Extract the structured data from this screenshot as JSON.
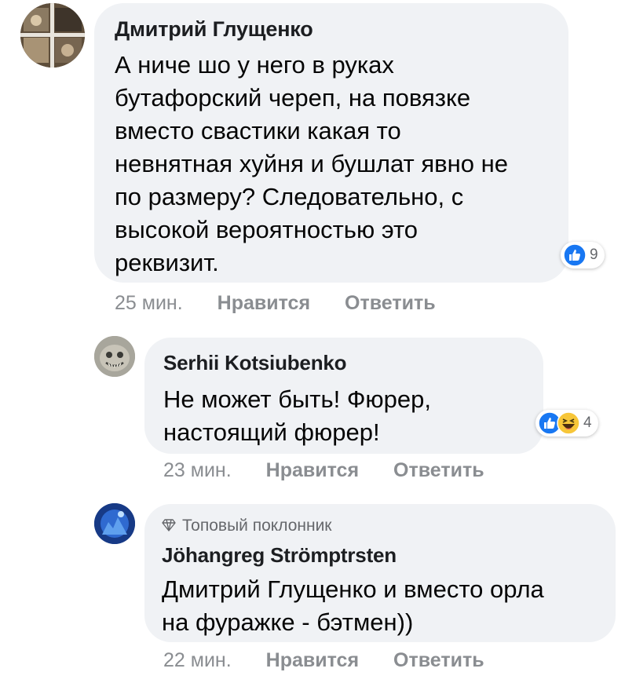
{
  "comments": [
    {
      "author": "Дмитрий Глущенко",
      "text": "А ниче шо у него в руках\nбутафорский череп, на повязке\nвместо свастики какая то\nневнятная хуйня и бушлат явно не\nпо размеру? Следовательно, с\nвысокой вероятностью это\nреквизит.",
      "reactions": {
        "icons": [
          "like-icon"
        ],
        "count": "9"
      },
      "time": "25 мин.",
      "like_label": "Нравится",
      "reply_label": "Ответить"
    },
    {
      "author": "Serhii Kotsiubenko",
      "text": "Не может быть! Фюрер,\nнастоящий фюрер!",
      "reactions": {
        "icons": [
          "like-icon",
          "haha-icon"
        ],
        "count": "4"
      },
      "time": "23 мин.",
      "like_label": "Нравится",
      "reply_label": "Ответить"
    },
    {
      "badge": "Топовый поклонник",
      "author": "Jöhangreg Strömptrsten",
      "text": "Дмитрий Глущенко и вместо орла\nна фуражке - бэтмен))",
      "time": "22 мин.",
      "like_label": "Нравится",
      "reply_label": "Ответить"
    }
  ],
  "colors": {
    "bubble": "#f0f2f5",
    "like_blue": "#1877f2",
    "haha_yellow": "#f7c639",
    "meta_gray": "#8a8d91"
  }
}
